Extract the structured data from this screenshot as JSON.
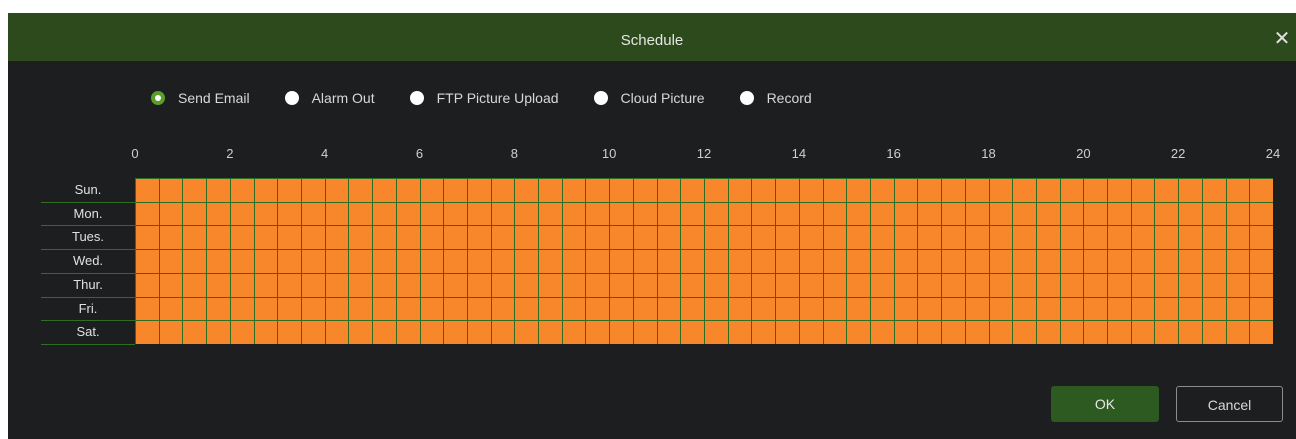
{
  "dialog": {
    "title": "Schedule",
    "close_label": "✕"
  },
  "radio_options": [
    {
      "label": "Send Email",
      "selected": true
    },
    {
      "label": "Alarm Out",
      "selected": false
    },
    {
      "label": "FTP Picture Upload",
      "selected": false
    },
    {
      "label": "Cloud Picture",
      "selected": false
    },
    {
      "label": "Record",
      "selected": false
    }
  ],
  "hour_labels": [
    "0",
    "2",
    "4",
    "6",
    "8",
    "10",
    "12",
    "14",
    "16",
    "18",
    "20",
    "22",
    "24"
  ],
  "days": [
    "Sun.",
    "Mon.",
    "Tues.",
    "Wed.",
    "Thur.",
    "Fri.",
    "Sat."
  ],
  "schedule": {
    "slots_per_day": 48,
    "all_slots_enabled": true,
    "enabled_color": "#f7872a"
  },
  "buttons": {
    "ok_label": "OK",
    "cancel_label": "Cancel"
  },
  "colors": {
    "titlebar": "#2d4a1d",
    "background": "#1d1e20",
    "accent": "#5a9e2a"
  }
}
